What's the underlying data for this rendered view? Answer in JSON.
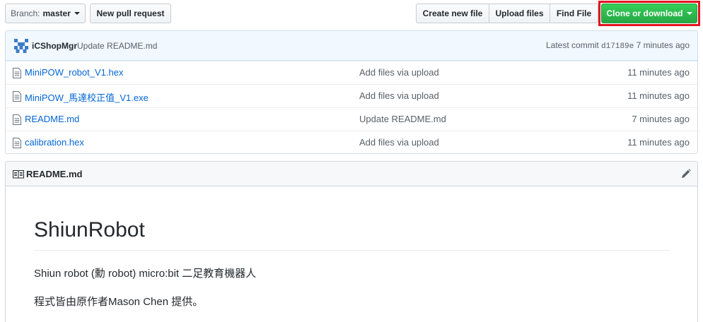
{
  "toolbar": {
    "branch_prefix": "Branch:",
    "branch_name": "master",
    "new_pull_request": "New pull request",
    "create_new_file": "Create new file",
    "upload_files": "Upload files",
    "find_file": "Find File",
    "clone_or_download": "Clone or download"
  },
  "commit": {
    "author": "iCShopMgr",
    "message": "Update README.md",
    "latest_label": "Latest commit",
    "sha": "d17189e",
    "age": "7 minutes ago"
  },
  "files": [
    {
      "name": "MiniPOW_robot_V1.hex",
      "message": "Add files via upload",
      "age": "11 minutes ago"
    },
    {
      "name": "MiniPOW_馬達校正值_V1.exe",
      "message": "Add files via upload",
      "age": "11 minutes ago"
    },
    {
      "name": "README.md",
      "message": "Update README.md",
      "age": "7 minutes ago"
    },
    {
      "name": "calibration.hex",
      "message": "Add files via upload",
      "age": "11 minutes ago"
    }
  ],
  "readme": {
    "header": "README.md",
    "title": "ShiunRobot",
    "paragraph1": "Shiun robot (勳 robot) micro:bit 二足教育機器人",
    "paragraph2": "程式皆由原作者Mason Chen 提供。"
  },
  "colors": {
    "accent_green": "#28a745",
    "link_blue": "#0366d6",
    "highlight_red": "#e4141f",
    "commit_bar_bg": "#f1f8ff"
  },
  "icons": [
    "caret-down-icon",
    "avatar-identicon",
    "file-icon",
    "book-icon",
    "pencil-icon"
  ]
}
